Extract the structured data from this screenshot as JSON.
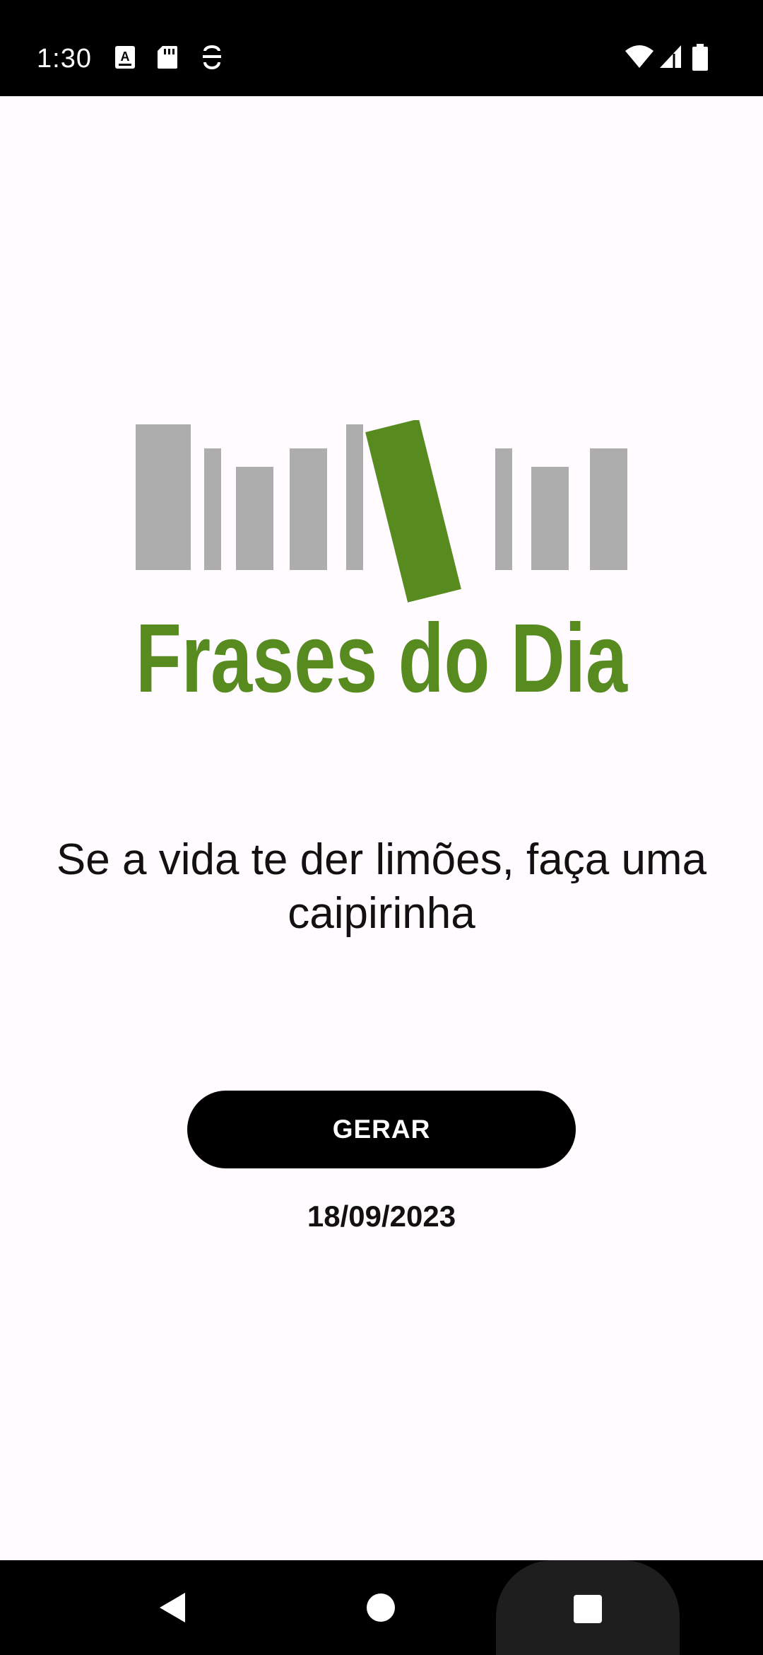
{
  "status_bar": {
    "time": "1:30",
    "left_icons": [
      "keyboard-a-icon",
      "sd-card-icon",
      "accessibility-icon"
    ],
    "right_icons": [
      "wifi-icon",
      "signal-icon",
      "battery-icon"
    ]
  },
  "logo": {
    "text": "Frases do Dia",
    "colors": {
      "bars": "#adadad",
      "accent": "#578a1f"
    }
  },
  "quote": {
    "text": "Se a vida te der limões, faça uma caipirinha"
  },
  "generate_button": {
    "label": "GERAR"
  },
  "date": "18/09/2023",
  "nav_bar": {
    "buttons": [
      "back-icon",
      "home-icon",
      "recents-icon"
    ]
  },
  "theme": {
    "background": "#fffbfe",
    "button": "#000000",
    "button_text": "#ffffff"
  }
}
